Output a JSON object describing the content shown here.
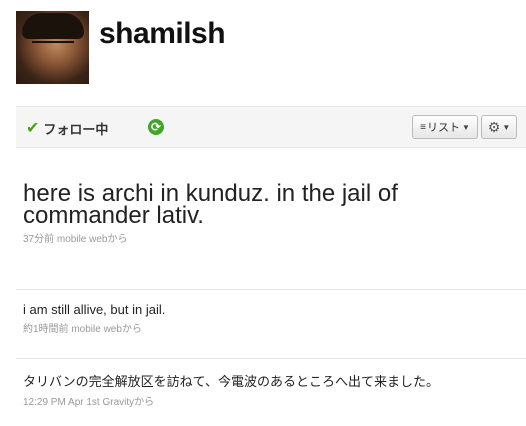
{
  "profile": {
    "username": "shamilsh"
  },
  "actions": {
    "following_label": "フォロー中",
    "list_label": "リスト",
    "colors": {
      "accent_green": "#46a316"
    }
  },
  "tweets": [
    {
      "text": "here is archi in kunduz. in the jail of commander lativ.",
      "time": "37分前",
      "source": "mobile web",
      "suffix": "から"
    },
    {
      "text": "i am still allive, but in jail.",
      "time": "約1時間前",
      "source": "mobile web",
      "suffix": "から"
    },
    {
      "text": "タリバンの完全解放区を訪ねて、今電波のあるところへ出て来ました。",
      "time": "12:29 PM Apr 1st",
      "source": "Gravity",
      "suffix": "から"
    }
  ]
}
